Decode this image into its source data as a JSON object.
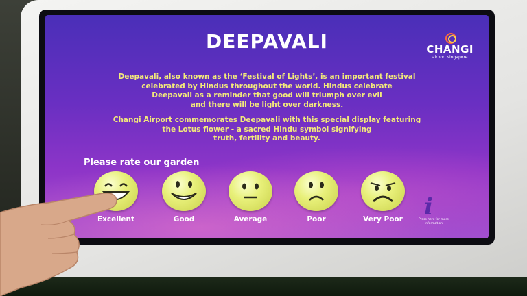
{
  "screen": {
    "title": "DEEPAVALI",
    "logo": {
      "word": "CHANGI",
      "sub": "airport singapore"
    },
    "paragraph_1_lines": [
      "Deepavali, also known as the ‘Festival of Lights’, is an important festival",
      "celebrated by Hindus throughout the world. Hindus celebrate",
      "Deepavali as a reminder that good will triumph over evil",
      "and there will be light over darkness."
    ],
    "paragraph_2_lines": [
      "Changi Airport commemorates Deepavali with this special display featuring",
      "the Lotus flower - a sacred Hindu symbol signifying",
      "truth, fertility and beauty."
    ],
    "prompt": "Please rate our garden",
    "ratings": [
      {
        "label": "Excellent",
        "mood": "excellent"
      },
      {
        "label": "Good",
        "mood": "good"
      },
      {
        "label": "Average",
        "mood": "average"
      },
      {
        "label": "Poor",
        "mood": "poor"
      },
      {
        "label": "Very Poor",
        "mood": "very-poor"
      }
    ],
    "info": {
      "glyph": "i",
      "text": "Press here for more information"
    }
  }
}
